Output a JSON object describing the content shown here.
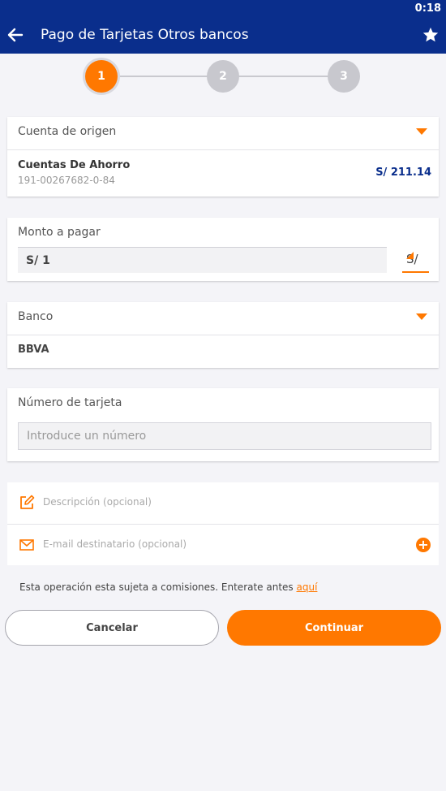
{
  "status_bar": {
    "time": "0:18"
  },
  "header": {
    "title": "Pago de Tarjetas Otros bancos"
  },
  "stepper": {
    "steps": [
      "1",
      "2",
      "3"
    ],
    "active_step": 1
  },
  "origin_account": {
    "label": "Cuenta de origen",
    "account_name": "Cuentas De Ahorro",
    "account_number": "191-00267682-0-84",
    "balance": "S/ 211.14"
  },
  "amount": {
    "label": "Monto a pagar",
    "value": "S/ 1",
    "currency": "S/"
  },
  "bank": {
    "label": "Banco",
    "value": "BBVA"
  },
  "card_number": {
    "label": "Número de tarjeta",
    "placeholder": "Introduce un número",
    "value": ""
  },
  "optional": {
    "description_placeholder": "Descripción (opcional)",
    "email_placeholder": "E-mail destinatario (opcional)"
  },
  "notice": {
    "text": "Esta operación esta sujeta a comisiones. Enterate antes ",
    "link": "aquí"
  },
  "buttons": {
    "cancel": "Cancelar",
    "continue": "Continuar"
  },
  "colors": {
    "primary_blue": "#0a2e8c",
    "accent_orange": "#ff7800",
    "background": "#f4f4f8"
  },
  "icons": [
    "back-arrow-icon",
    "star-icon",
    "chevron-down-icon",
    "edit-icon",
    "mail-icon",
    "plus-icon"
  ]
}
